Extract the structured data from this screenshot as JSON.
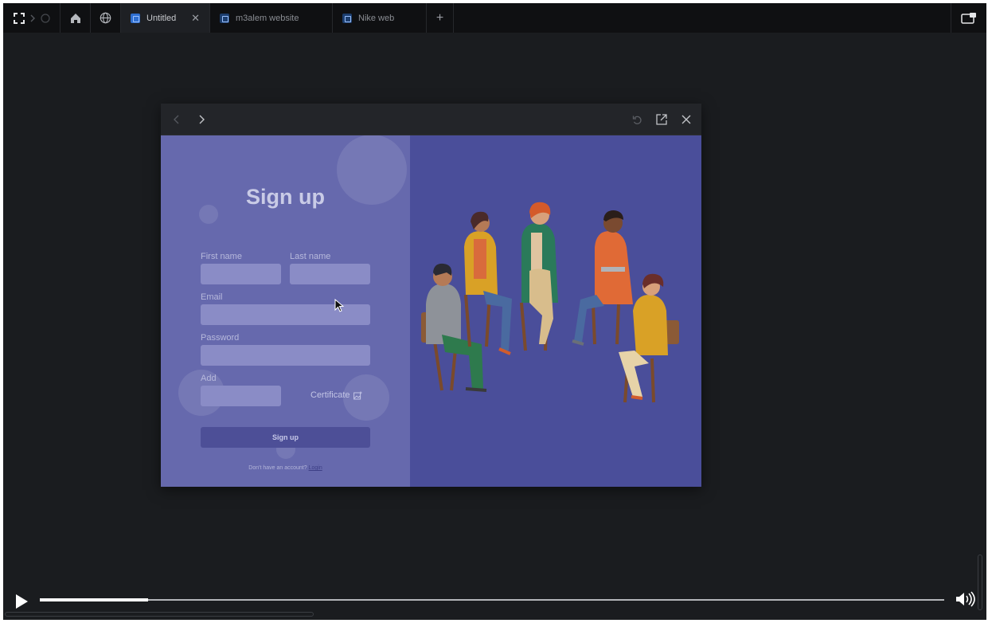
{
  "tabbar": {
    "tabs": [
      {
        "label": "Untitled",
        "active": true
      },
      {
        "label": "m3alem website",
        "active": false
      },
      {
        "label": "Nike web",
        "active": false
      }
    ],
    "new_tab": "+"
  },
  "signup": {
    "title": "Sign up",
    "first_name_label": "First name",
    "last_name_label": "Last name",
    "email_label": "Email",
    "password_label": "Password",
    "add_label": "Add",
    "certificate_label": "Certificate",
    "button_label": "Sign up",
    "footer_text": "Don't have an account?",
    "footer_link": "Login"
  },
  "player": {
    "progress_fraction": 0.12
  },
  "colors": {
    "left_panel": "#6669ad",
    "right_panel": "#4a4e9a",
    "tab_active_accent": "#2f6fd0"
  }
}
